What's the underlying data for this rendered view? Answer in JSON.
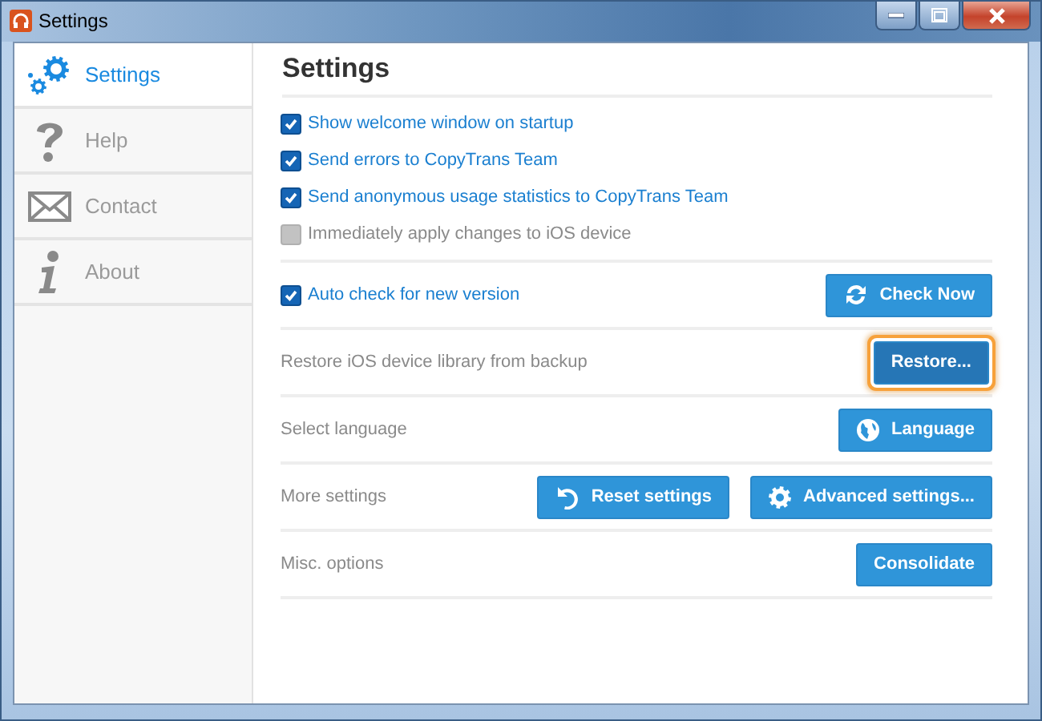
{
  "window": {
    "title": "Settings"
  },
  "sidebar": {
    "items": [
      {
        "label": "Settings",
        "kind": "gears",
        "selected": true
      },
      {
        "label": "Help",
        "kind": "question",
        "selected": false
      },
      {
        "label": "Contact",
        "kind": "envelope",
        "selected": false
      },
      {
        "label": "About",
        "kind": "info",
        "selected": false
      }
    ]
  },
  "heading": "Settings",
  "checkboxes": [
    {
      "label": "Show welcome window on startup",
      "checked": true,
      "disabled": false
    },
    {
      "label": "Send errors to CopyTrans Team",
      "checked": true,
      "disabled": false
    },
    {
      "label": "Send anonymous usage statistics to CopyTrans Team",
      "checked": true,
      "disabled": false
    },
    {
      "label": "Immediately apply changes to iOS device",
      "checked": false,
      "disabled": true
    }
  ],
  "rows": [
    {
      "kind": "checkbox",
      "label": "Auto check for new version",
      "checked": true,
      "buttons": [
        {
          "label": "Check Now",
          "kind": "refresh",
          "highlighted": false
        }
      ]
    },
    {
      "kind": "text",
      "label": "Restore iOS device library from backup",
      "buttons": [
        {
          "label": "Restore...",
          "kind": "plain",
          "highlighted": true
        }
      ]
    },
    {
      "kind": "text",
      "label": "Select language",
      "buttons": [
        {
          "label": "Language",
          "kind": "globe",
          "highlighted": false
        }
      ]
    },
    {
      "kind": "text",
      "label": "More settings",
      "buttons": [
        {
          "label": "Reset settings",
          "kind": "undo",
          "highlighted": false
        },
        {
          "label": "Advanced settings...",
          "kind": "gear",
          "highlighted": false
        }
      ]
    },
    {
      "kind": "text",
      "label": "Misc. options",
      "buttons": [
        {
          "label": "Consolidate",
          "kind": "plain",
          "highlighted": false
        }
      ]
    }
  ]
}
